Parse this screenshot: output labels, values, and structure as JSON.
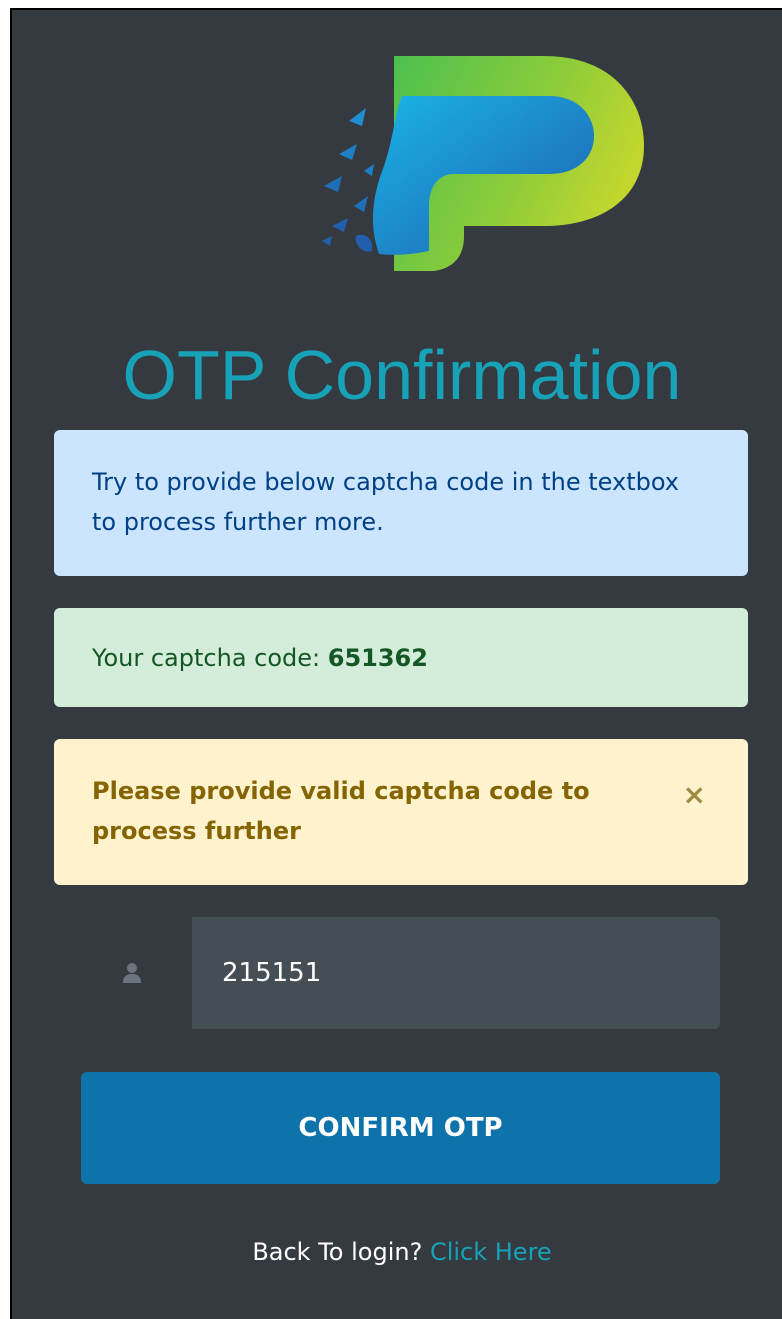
{
  "title": "OTP Confirmation",
  "info_alert": {
    "text": "Try to provide below captcha code in the textbox to process further more."
  },
  "captcha_alert": {
    "label": "Your captcha code: ",
    "code": "651362"
  },
  "warning_alert": {
    "text": "Please provide valid captcha code to process further",
    "close_symbol": "×"
  },
  "otp_field": {
    "value": "215151",
    "icon": "user-icon"
  },
  "confirm_button": {
    "label": "CONFIRM OTP"
  },
  "footer": {
    "text": "Back To login? ",
    "link_text": "Click Here"
  },
  "colors": {
    "panel_bg": "#343a40",
    "title": "#17a2b8",
    "button": "#0d73aa"
  }
}
